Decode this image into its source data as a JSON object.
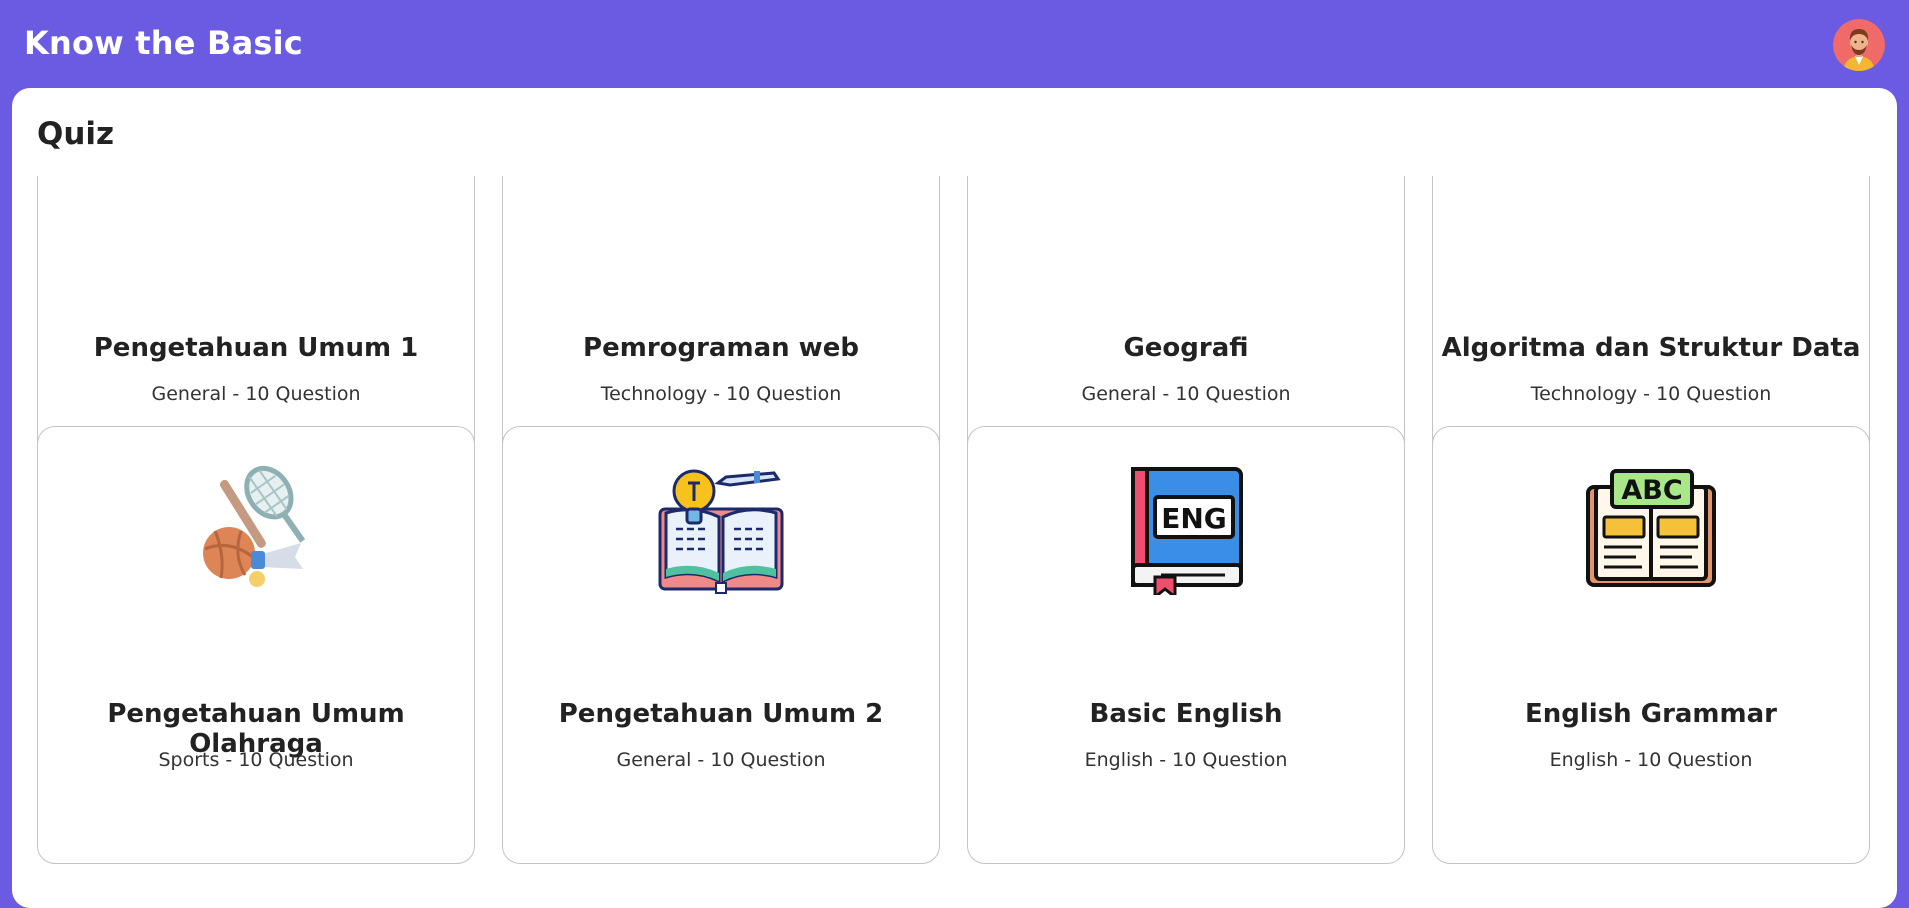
{
  "header": {
    "title": "Know the Basic",
    "accent_color": "#6b5be2",
    "avatar_icon": "user-avatar-icon"
  },
  "main": {
    "section_title": "Quiz",
    "quizzes": [
      {
        "title": "Pengetahuan Umum 1",
        "category": "General",
        "questions": "10 Question",
        "icon": "none"
      },
      {
        "title": "Pemrograman web",
        "category": "Technology",
        "questions": "10 Question",
        "icon": "none"
      },
      {
        "title": "Geografi",
        "category": "General",
        "questions": "10 Question",
        "icon": "none"
      },
      {
        "title": "Algoritma dan Struktur Data",
        "category": "Technology",
        "questions": "10 Question",
        "icon": "none"
      },
      {
        "title": "Pengetahuan Umum Olahraga",
        "category": "Sports",
        "questions": "10 Question",
        "icon": "sports-equipment-icon"
      },
      {
        "title": "Pengetahuan Umum 2",
        "category": "General",
        "questions": "10 Question",
        "icon": "open-book-lightbulb-icon"
      },
      {
        "title": "Basic English",
        "category": "English",
        "questions": "10 Question",
        "icon": "eng-book-icon"
      },
      {
        "title": "English Grammar",
        "category": "English",
        "questions": "10 Question",
        "icon": "abc-book-icon"
      }
    ]
  }
}
